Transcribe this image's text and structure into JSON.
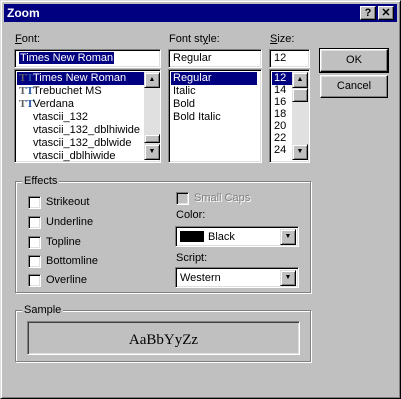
{
  "window": {
    "title": "Zoom",
    "help_label": "?",
    "close_label": "✕"
  },
  "font": {
    "label": "Font:",
    "value": "Times New Roman",
    "items": [
      {
        "label": "Times New Roman",
        "icon": "truetype-icon",
        "selected": true
      },
      {
        "label": "Trebuchet MS",
        "icon": "truetype-icon",
        "selected": false
      },
      {
        "label": "Verdana",
        "icon": "truetype-icon",
        "selected": false
      },
      {
        "label": "vtascii_132",
        "icon": "",
        "selected": false
      },
      {
        "label": "vtascii_132_dblhiwide",
        "icon": "",
        "selected": false
      },
      {
        "label": "vtascii_132_dblwide",
        "icon": "",
        "selected": false
      },
      {
        "label": "vtascii_dblhiwide",
        "icon": "",
        "selected": false
      }
    ]
  },
  "font_style": {
    "label": "Font style:",
    "value": "Regular",
    "items": [
      {
        "label": "Regular",
        "selected": true
      },
      {
        "label": "Italic",
        "selected": false
      },
      {
        "label": "Bold",
        "selected": false
      },
      {
        "label": "Bold Italic",
        "selected": false
      }
    ]
  },
  "size": {
    "label": "Size:",
    "value": "12",
    "items": [
      {
        "label": "12",
        "selected": true
      },
      {
        "label": "14",
        "selected": false
      },
      {
        "label": "16",
        "selected": false
      },
      {
        "label": "18",
        "selected": false
      },
      {
        "label": "20",
        "selected": false
      },
      {
        "label": "22",
        "selected": false
      },
      {
        "label": "24",
        "selected": false
      }
    ]
  },
  "buttons": {
    "ok": "OK",
    "cancel": "Cancel"
  },
  "effects": {
    "title": "Effects",
    "strikeout": "Strikeout",
    "underline": "Underline",
    "topline": "Topline",
    "bottomline": "Bottomline",
    "overline": "Overline",
    "small_caps": "Small Caps",
    "color_label": "Color:",
    "color_value": "Black",
    "script_label": "Script:",
    "script_value": "Western"
  },
  "sample": {
    "title": "Sample",
    "text": "AaBbYyZz"
  },
  "colors": {
    "title_bar": "#000080",
    "face": "#c0c0c0",
    "selection": "#000080"
  }
}
